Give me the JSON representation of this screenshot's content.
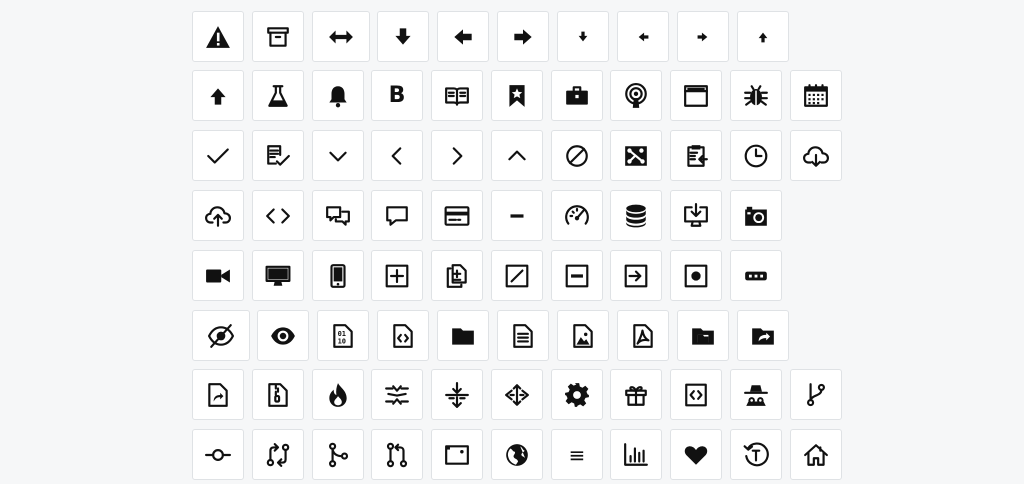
{
  "icon_grid": {
    "rows": [
      [
        "alert-icon",
        "archive-icon",
        "arrow-both-icon",
        "arrow-down-icon",
        "arrow-left-icon",
        "arrow-right-icon",
        "arrow-small-down-icon",
        "arrow-small-left-icon",
        "arrow-small-right-icon",
        "arrow-small-up-icon"
      ],
      [
        "arrow-up-icon",
        "beaker-icon",
        "bell-icon",
        "bold-icon",
        "book-icon",
        "bookmark-icon",
        "briefcase-icon",
        "broadcast-icon",
        "browser-icon",
        "bug-icon",
        "calendar-icon"
      ],
      [
        "check-icon",
        "checklist-icon",
        "chevron-down-icon",
        "chevron-left-icon",
        "chevron-right-icon",
        "chevron-up-icon",
        "circle-slash-icon",
        "circuit-board-icon",
        "clippy-icon",
        "clock-icon",
        "cloud-download-icon"
      ],
      [
        "cloud-upload-icon",
        "code-icon",
        "comment-discussion-icon",
        "comment-icon",
        "credit-card-icon",
        "dash-icon",
        "dashboard-icon",
        "database-icon",
        "desktop-download-icon",
        "device-camera-icon"
      ],
      [
        "device-camera-video-icon",
        "device-desktop-icon",
        "device-mobile-icon",
        "diff-added-icon",
        "diff-icon",
        "diff-modified-icon",
        "diff-removed-icon",
        "diff-renamed-icon",
        "diff-ignored-icon",
        "ellipsis-icon"
      ],
      [
        "eye-closed-icon",
        "eye-icon",
        "file-binary-icon",
        "file-code-icon",
        "file-directory-icon",
        "file-icon",
        "file-media-icon",
        "file-pdf-icon",
        "file-submodule-icon",
        "file-symlink-directory-icon"
      ],
      [
        "file-symlink-file-icon",
        "file-zip-icon",
        "flame-icon",
        "fold-icon",
        "fold-down-icon",
        "fold-up-icon",
        "gear-icon",
        "gift-icon",
        "gist-icon",
        "gist-secret-icon",
        "git-branch-icon"
      ],
      [
        "git-commit-icon",
        "git-compare-icon",
        "git-merge-icon",
        "git-pull-request-icon",
        "globe-icon",
        "globe-filled-icon",
        "grabber-icon",
        "graph-icon",
        "heart-icon",
        "history-icon",
        "home-icon"
      ]
    ],
    "bold_glyph": "B",
    "grabber_glyph": "≡",
    "colors": {
      "icon": "#111111",
      "tile_border": "#dfe2e5",
      "tile_bg": "#ffffff",
      "page_bg": "#f6f7f8"
    }
  }
}
